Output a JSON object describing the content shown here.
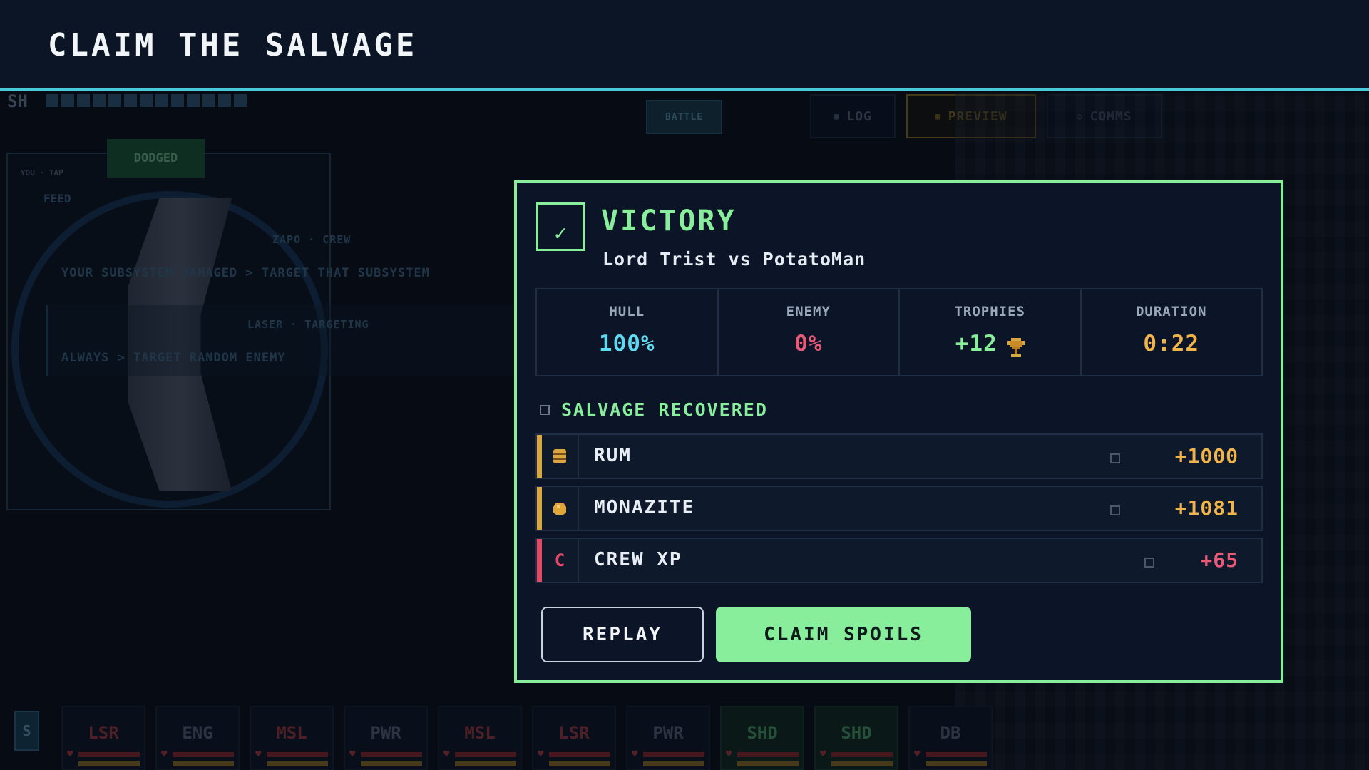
{
  "header": {
    "title": "CLAIM THE SALVAGE"
  },
  "background": {
    "shield_label": "SH",
    "shield_pips": 13,
    "tabs": {
      "battle": "BATTLE",
      "log": "LOG",
      "preview": "PREVIEW",
      "comms": "COMMS"
    },
    "dodged": "DODGED",
    "you_tap": "YOU · TAP",
    "feed": "FEED",
    "feed_lines": [
      "ZAPO · CREW",
      "YOUR SUBSYSTEM DAMAGED  >  TARGET THAT SUBSYSTEM",
      "LASER · TARGETING",
      "ALWAYS  >  TARGET RANDOM ENEMY"
    ],
    "subsystem_s": "S",
    "subsystems": [
      "LSR",
      "ENG",
      "MSL",
      "PWR",
      "MSL",
      "LSR",
      "PWR",
      "SHD",
      "SHD",
      "DB"
    ]
  },
  "modal": {
    "title": "VICTORY",
    "subtitle": "Lord Trist vs PotatoMan",
    "stats": {
      "hull_label": "HULL",
      "hull_value": "100%",
      "enemy_label": "ENEMY",
      "enemy_value": "0%",
      "trophies_label": "TROPHIES",
      "trophies_value": "+12",
      "duration_label": "DURATION",
      "duration_value": "0:22"
    },
    "salvage_heading": "SALVAGE RECOVERED",
    "salvage": [
      {
        "name": "RUM",
        "amount": "+1000",
        "icon": "barrel-icon",
        "accent": "#d9a640"
      },
      {
        "name": "MONAZITE",
        "amount": "+1081",
        "icon": "ore-icon",
        "accent": "#d9a640"
      },
      {
        "name": "CREW XP",
        "amount": "+65",
        "icon": "crew-icon",
        "icon_glyph": "C",
        "accent": "#e04a66"
      }
    ],
    "buttons": {
      "replay": "REPLAY",
      "claim": "CLAIM SPOILS"
    }
  },
  "colors": {
    "accent_green": "#88ee9c",
    "hull_blue": "#5ed9f0",
    "enemy_red": "#e85a78",
    "gold": "#f0b54a",
    "header_rule": "#4ac9d9"
  }
}
